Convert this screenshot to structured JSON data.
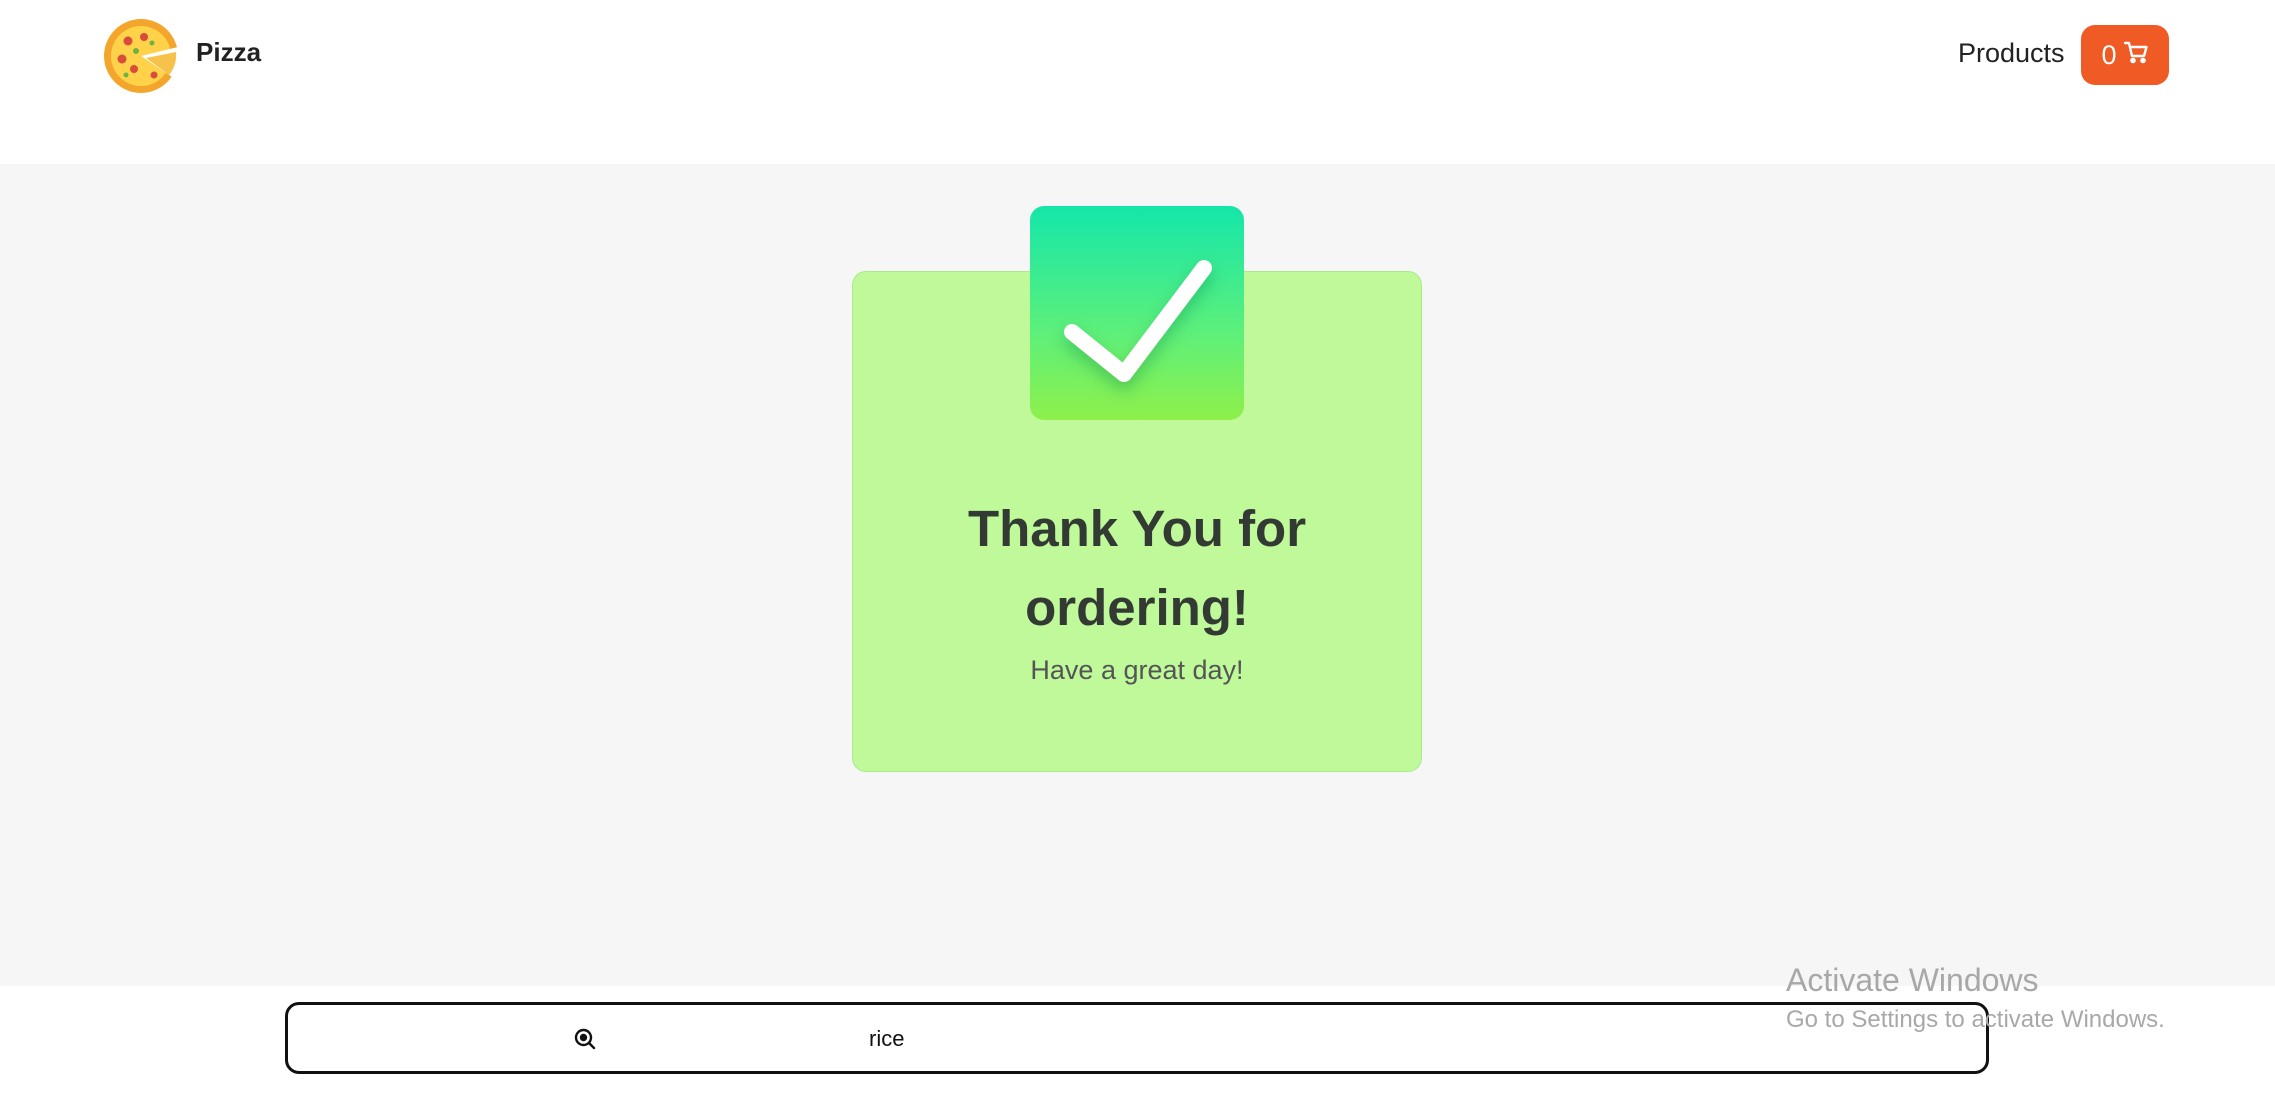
{
  "header": {
    "brand": "Pizza",
    "logo_icon": "pizza-icon",
    "nav": {
      "products_label": "Products"
    },
    "cart": {
      "count": "0",
      "icon": "cart-icon",
      "color": "#f05a24"
    }
  },
  "confirmation": {
    "icon": "checkmark-icon",
    "title": "Thank You for\nordering!",
    "subtitle": "Have a great day!",
    "card_color": "#bff99a"
  },
  "search": {
    "icon": "search-icon",
    "value": "rice"
  },
  "watermark": {
    "title": "Activate Windows",
    "subtitle": "Go to Settings to activate Windows."
  }
}
